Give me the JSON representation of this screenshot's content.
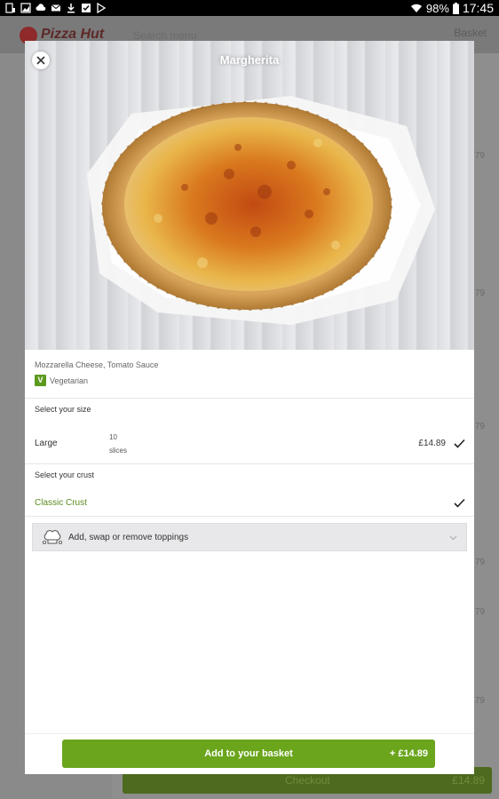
{
  "status_bar": {
    "battery": "98%",
    "time": "17:45"
  },
  "background_app": {
    "brand": "Pizza Hut",
    "search_placeholder": "Search menu",
    "basket_label": "Basket",
    "item_prices": [
      "£...79",
      "£...79",
      "£...79",
      "£...79",
      "£...79",
      "£...79"
    ],
    "checkout_label": "Checkout",
    "checkout_total": "£14.89"
  },
  "modal": {
    "title": "Margherita",
    "description": "Mozzarella Cheese, Tomato Sauce",
    "dietary_badge": "V",
    "dietary_label": "Vegetarian",
    "size_section": {
      "title": "Select your size",
      "option": {
        "name": "Large",
        "slices_count": "10",
        "slices_label": "slices",
        "price": "£14.89",
        "selected": true
      }
    },
    "crust_section": {
      "title": "Select your crust",
      "option": {
        "name": "Classic Crust",
        "selected": true
      }
    },
    "toppings_button": "Add, swap or remove toppings",
    "add_button": {
      "label": "Add to your basket",
      "price": "+ £14.89"
    }
  },
  "colors": {
    "accent_green": "#6aa51c",
    "crust_text_green": "#5c8a1e",
    "veg_badge_green": "#5c9a1e"
  }
}
